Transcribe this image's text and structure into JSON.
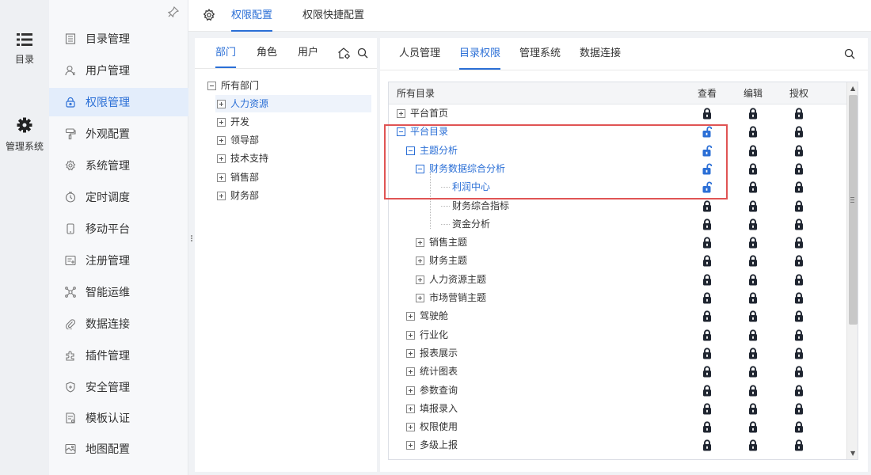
{
  "rail": {
    "items": [
      {
        "label": "目录",
        "icon": "list-icon"
      },
      {
        "label": "管理系统",
        "icon": "gear-icon"
      }
    ]
  },
  "menu": {
    "items": [
      {
        "label": "目录管理",
        "icon": "catalog-icon"
      },
      {
        "label": "用户管理",
        "icon": "user-icon"
      },
      {
        "label": "权限管理",
        "icon": "lock-icon",
        "active": true
      },
      {
        "label": "外观配置",
        "icon": "brush-icon"
      },
      {
        "label": "系统管理",
        "icon": "settings-icon"
      },
      {
        "label": "定时调度",
        "icon": "clock-icon"
      },
      {
        "label": "移动平台",
        "icon": "mobile-icon"
      },
      {
        "label": "注册管理",
        "icon": "register-icon"
      },
      {
        "label": "智能运维",
        "icon": "ops-icon"
      },
      {
        "label": "数据连接",
        "icon": "link-icon"
      },
      {
        "label": "插件管理",
        "icon": "plugin-icon"
      },
      {
        "label": "安全管理",
        "icon": "shield-icon"
      },
      {
        "label": "模板认证",
        "icon": "template-icon"
      },
      {
        "label": "地图配置",
        "icon": "map-icon"
      }
    ]
  },
  "topbar": {
    "tabs": [
      {
        "label": "权限配置",
        "active": true
      },
      {
        "label": "权限快捷配置",
        "active": false
      }
    ]
  },
  "dept_panel": {
    "tabs": [
      {
        "label": "部门",
        "active": true
      },
      {
        "label": "角色",
        "active": false
      },
      {
        "label": "用户",
        "active": false
      }
    ],
    "tree": {
      "root": "所有部门",
      "children": [
        "人力资源",
        "开发",
        "领导部",
        "技术支持",
        "销售部",
        "财务部"
      ],
      "selected": "人力资源"
    }
  },
  "perm_panel": {
    "tabs": [
      {
        "label": "人员管理",
        "active": false
      },
      {
        "label": "目录权限",
        "active": true
      },
      {
        "label": "管理系统",
        "active": false
      },
      {
        "label": "数据连接",
        "active": false
      }
    ],
    "columns": [
      "所有目录",
      "查看",
      "编辑",
      "授权"
    ],
    "rows": [
      {
        "label": "平台首页",
        "level": 0,
        "toggle": "plus",
        "highlight": false,
        "view": "locked",
        "edit": "locked",
        "grant": "locked"
      },
      {
        "label": "平台目录",
        "level": 0,
        "toggle": "minus",
        "highlight": true,
        "view": "unlocked",
        "edit": "locked",
        "grant": "locked"
      },
      {
        "label": "主题分析",
        "level": 1,
        "toggle": "minus",
        "highlight": true,
        "view": "unlocked",
        "edit": "locked",
        "grant": "locked"
      },
      {
        "label": "财务数据综合分析",
        "level": 2,
        "toggle": "minus",
        "highlight": true,
        "view": "unlocked",
        "edit": "locked",
        "grant": "locked"
      },
      {
        "label": "利润中心",
        "level": 3,
        "toggle": "none",
        "highlight": true,
        "view": "unlocked",
        "edit": "locked",
        "grant": "locked"
      },
      {
        "label": "财务综合指标",
        "level": 3,
        "toggle": "none",
        "highlight": false,
        "view": "locked",
        "edit": "locked",
        "grant": "locked"
      },
      {
        "label": "资金分析",
        "level": 3,
        "toggle": "none",
        "highlight": false,
        "view": "locked",
        "edit": "locked",
        "grant": "locked"
      },
      {
        "label": "销售主题",
        "level": 2,
        "toggle": "plus",
        "highlight": false,
        "view": "locked",
        "edit": "locked",
        "grant": "locked"
      },
      {
        "label": "财务主题",
        "level": 2,
        "toggle": "plus",
        "highlight": false,
        "view": "locked",
        "edit": "locked",
        "grant": "locked"
      },
      {
        "label": "人力资源主题",
        "level": 2,
        "toggle": "plus",
        "highlight": false,
        "view": "locked",
        "edit": "locked",
        "grant": "locked"
      },
      {
        "label": "市场营销主题",
        "level": 2,
        "toggle": "plus",
        "highlight": false,
        "view": "locked",
        "edit": "locked",
        "grant": "locked"
      },
      {
        "label": "驾驶舱",
        "level": 1,
        "toggle": "plus",
        "highlight": false,
        "view": "locked",
        "edit": "locked",
        "grant": "locked"
      },
      {
        "label": "行业化",
        "level": 1,
        "toggle": "plus",
        "highlight": false,
        "view": "locked",
        "edit": "locked",
        "grant": "locked"
      },
      {
        "label": "报表展示",
        "level": 1,
        "toggle": "plus",
        "highlight": false,
        "view": "locked",
        "edit": "locked",
        "grant": "locked"
      },
      {
        "label": "统计图表",
        "level": 1,
        "toggle": "plus",
        "highlight": false,
        "view": "locked",
        "edit": "locked",
        "grant": "locked"
      },
      {
        "label": "参数查询",
        "level": 1,
        "toggle": "plus",
        "highlight": false,
        "view": "locked",
        "edit": "locked",
        "grant": "locked"
      },
      {
        "label": "填报录入",
        "level": 1,
        "toggle": "plus",
        "highlight": false,
        "view": "locked",
        "edit": "locked",
        "grant": "locked"
      },
      {
        "label": "权限使用",
        "level": 1,
        "toggle": "plus",
        "highlight": false,
        "view": "locked",
        "edit": "locked",
        "grant": "locked"
      },
      {
        "label": "多级上报",
        "level": 1,
        "toggle": "plus",
        "highlight": false,
        "view": "locked",
        "edit": "locked",
        "grant": "locked"
      }
    ]
  },
  "colors": {
    "accent": "#2b6fd6",
    "lock_dark": "#1f2530",
    "annotation_red": "#e05454"
  }
}
